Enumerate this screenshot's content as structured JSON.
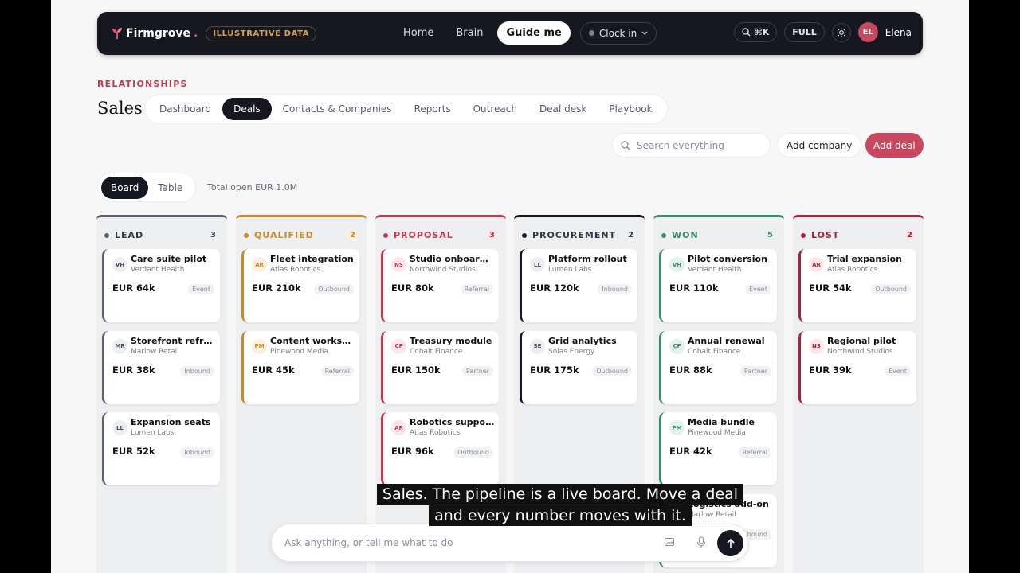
{
  "brand": {
    "name": "Firmgrove",
    "dot": ".",
    "badge": "ILLUSTRATIVE DATA"
  },
  "nav": {
    "links": [
      "Home",
      "Brain"
    ],
    "guide": "Guide me",
    "clock": "Clock in",
    "search_shortcut": "⌘K",
    "mode": "FULL",
    "user_initials": "EL",
    "user_name": "Elena"
  },
  "section": {
    "kicker": "RELATIONSHIPS",
    "title": "Sales"
  },
  "tabs": [
    "Dashboard",
    "Deals",
    "Contacts & Companies",
    "Reports",
    "Outreach",
    "Deal desk",
    "Playbook"
  ],
  "active_tab": "Deals",
  "toolbar": {
    "search_placeholder": "Search everything",
    "add_company": "Add company",
    "add_deal": "Add deal"
  },
  "view": {
    "board": "Board",
    "table": "Table",
    "total_open": "Total open EUR 1.0M"
  },
  "colors": {
    "accent": "#c8485f",
    "dark": "#151821"
  },
  "columns": [
    {
      "title": "LEAD",
      "count": "3",
      "color": "#5b616e",
      "count_bg": "transparent",
      "cards": [
        {
          "initials": "VH",
          "title": "Care suite pilot",
          "company": "Verdant Health",
          "amount": "EUR 64k",
          "tag": "Event"
        },
        {
          "initials": "MR",
          "title": "Storefront refr…",
          "company": "Marlow Retail",
          "amount": "EUR 38k",
          "tag": "Inbound"
        },
        {
          "initials": "LL",
          "title": "Expansion seats",
          "company": "Lumen Labs",
          "amount": "EUR 52k",
          "tag": "Inbound"
        }
      ]
    },
    {
      "title": "QUALIFIED",
      "count": "2",
      "color": "#c98a2a",
      "count_bg": "#fbf0dd",
      "cards": [
        {
          "initials": "AR",
          "title": "Fleet integration",
          "company": "Atlas Robotics",
          "amount": "EUR 210k",
          "tag": "Outbound"
        },
        {
          "initials": "PM",
          "title": "Content works…",
          "company": "Pinewood Media",
          "amount": "EUR 45k",
          "tag": "Referral"
        }
      ]
    },
    {
      "title": "PROPOSAL",
      "count": "3",
      "color": "#c2394f",
      "count_bg": "#fbe6ea",
      "cards": [
        {
          "initials": "NS",
          "title": "Studio onboar…",
          "company": "Northwind Studios",
          "amount": "EUR 80k",
          "tag": "Referral"
        },
        {
          "initials": "CF",
          "title": "Treasury module",
          "company": "Cobalt Finance",
          "amount": "EUR 150k",
          "tag": "Partner"
        },
        {
          "initials": "AR",
          "title": "Robotics suppo…",
          "company": "Atlas Robotics",
          "amount": "EUR 96k",
          "tag": "Outbound"
        }
      ]
    },
    {
      "title": "PROCUREMENT",
      "count": "2",
      "color": "#151821",
      "count_bg": "transparent",
      "cards": [
        {
          "initials": "LL",
          "title": "Platform rollout",
          "company": "Lumen Labs",
          "amount": "EUR 120k",
          "tag": "Inbound"
        },
        {
          "initials": "SE",
          "title": "Grid analytics",
          "company": "Solas Energy",
          "amount": "EUR 175k",
          "tag": "Outbound"
        }
      ]
    },
    {
      "title": "WON",
      "count": "5",
      "color": "#3f8a6a",
      "count_bg": "#e2f1ea",
      "cards": [
        {
          "initials": "VH",
          "title": "Pilot conversion",
          "company": "Verdant Health",
          "amount": "EUR 110k",
          "tag": "Event"
        },
        {
          "initials": "CF",
          "title": "Annual renewal",
          "company": "Cobalt Finance",
          "amount": "EUR 88k",
          "tag": "Partner"
        },
        {
          "initials": "PM",
          "title": "Media bundle",
          "company": "Pinewood Media",
          "amount": "EUR 42k",
          "tag": "Referral"
        },
        {
          "initials": "MR",
          "title": "Logistics add-on",
          "company": "Marlow Retail",
          "amount": "",
          "tag": "Inbound"
        }
      ]
    },
    {
      "title": "LOST",
      "count": "2",
      "color": "#a3243a",
      "count_bg": "#fbe6ea",
      "cards": [
        {
          "initials": "AR",
          "title": "Trial expansion",
          "company": "Atlas Robotics",
          "amount": "EUR 54k",
          "tag": "Outbound"
        },
        {
          "initials": "NS",
          "title": "Regional pilot",
          "company": "Northwind Studios",
          "amount": "EUR 39k",
          "tag": "Event"
        }
      ]
    }
  ],
  "caption": "Sales. The pipeline is a live board. Move a deal and every number moves with it.",
  "assistant": {
    "placeholder": "Ask anything, or tell me what to do"
  }
}
